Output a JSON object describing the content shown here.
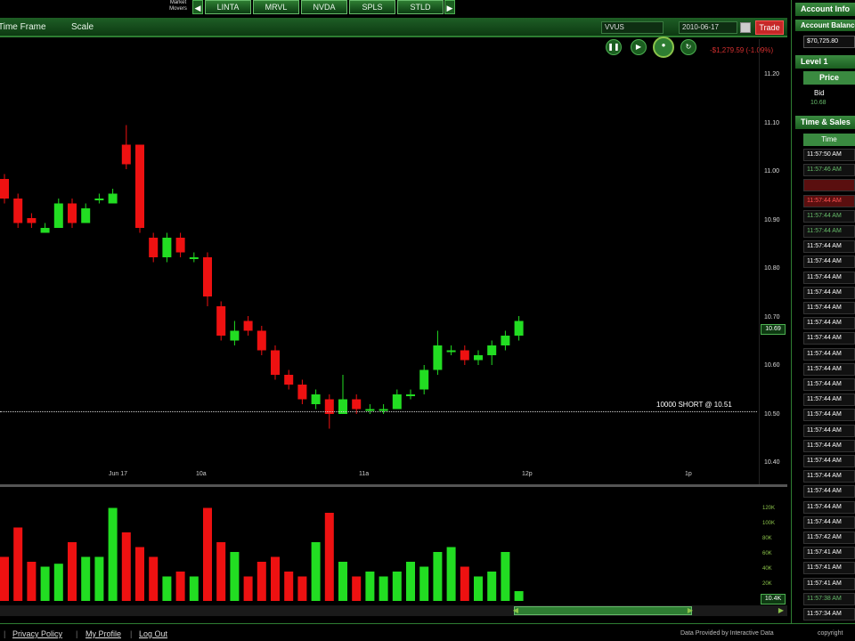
{
  "top_strip": {
    "movers_label": "Market Movers",
    "tickers": [
      "LINTA",
      "MRVL",
      "NVDA",
      "SPLS",
      "STLD"
    ]
  },
  "chart_header": {
    "time_frame_label": "Time Frame",
    "scale_label": "Scale",
    "symbol": "VVUS",
    "date": "2010-06-17",
    "trade_label": "Trade",
    "pnl": "-$1,279.59 (-1.09%)"
  },
  "price_axis": [
    "11.20",
    "11.10",
    "11.00",
    "10.90",
    "10.80",
    "10.70",
    "10.60",
    "10.50",
    "10.40"
  ],
  "current_price": "10.69",
  "position": "10000 SHORT @ 10.51",
  "time_axis": [
    "Jun 17",
    "10a",
    "11a",
    "12p",
    "1p"
  ],
  "volume_axis": [
    "120K",
    "100K",
    "80K",
    "60K",
    "40K",
    "20K"
  ],
  "volume_current": "10.4K",
  "chart_data": {
    "type": "candlestick",
    "ylim": [
      10.4,
      11.2
    ],
    "candles": [
      {
        "o": 10.98,
        "c": 10.94,
        "h": 10.99,
        "l": 10.93
      },
      {
        "o": 10.94,
        "c": 10.89,
        "h": 10.95,
        "l": 10.88
      },
      {
        "o": 10.9,
        "c": 10.89,
        "h": 10.91,
        "l": 10.88
      },
      {
        "o": 10.87,
        "c": 10.88,
        "h": 10.89,
        "l": 10.87
      },
      {
        "o": 10.88,
        "c": 10.93,
        "h": 10.94,
        "l": 10.88
      },
      {
        "o": 10.93,
        "c": 10.89,
        "h": 10.94,
        "l": 10.88
      },
      {
        "o": 10.89,
        "c": 10.92,
        "h": 10.93,
        "l": 10.89
      },
      {
        "o": 10.94,
        "c": 10.94,
        "h": 10.95,
        "l": 10.93
      },
      {
        "o": 10.93,
        "c": 10.95,
        "h": 10.96,
        "l": 10.93
      },
      {
        "o": 11.05,
        "c": 11.01,
        "h": 11.09,
        "l": 11.0
      },
      {
        "o": 11.05,
        "c": 10.88,
        "h": 11.05,
        "l": 10.87
      },
      {
        "o": 10.86,
        "c": 10.82,
        "h": 10.87,
        "l": 10.81
      },
      {
        "o": 10.82,
        "c": 10.86,
        "h": 10.87,
        "l": 10.81
      },
      {
        "o": 10.86,
        "c": 10.83,
        "h": 10.87,
        "l": 10.82
      },
      {
        "o": 10.82,
        "c": 10.82,
        "h": 10.83,
        "l": 10.81
      },
      {
        "o": 10.82,
        "c": 10.74,
        "h": 10.83,
        "l": 10.72
      },
      {
        "o": 10.72,
        "c": 10.66,
        "h": 10.73,
        "l": 10.65
      },
      {
        "o": 10.65,
        "c": 10.67,
        "h": 10.69,
        "l": 10.64
      },
      {
        "o": 10.69,
        "c": 10.67,
        "h": 10.7,
        "l": 10.66
      },
      {
        "o": 10.67,
        "c": 10.63,
        "h": 10.68,
        "l": 10.62
      },
      {
        "o": 10.63,
        "c": 10.58,
        "h": 10.64,
        "l": 10.57
      },
      {
        "o": 10.58,
        "c": 10.56,
        "h": 10.59,
        "l": 10.55
      },
      {
        "o": 10.56,
        "c": 10.53,
        "h": 10.57,
        "l": 10.52
      },
      {
        "o": 10.52,
        "c": 10.54,
        "h": 10.55,
        "l": 10.51
      },
      {
        "o": 10.53,
        "c": 10.5,
        "h": 10.54,
        "l": 10.47
      },
      {
        "o": 10.5,
        "c": 10.53,
        "h": 10.58,
        "l": 10.5
      },
      {
        "o": 10.53,
        "c": 10.51,
        "h": 10.54,
        "l": 10.5
      },
      {
        "o": 10.51,
        "c": 10.51,
        "h": 10.52,
        "l": 10.5
      },
      {
        "o": 10.51,
        "c": 10.51,
        "h": 10.52,
        "l": 10.5
      },
      {
        "o": 10.51,
        "c": 10.54,
        "h": 10.55,
        "l": 10.51
      },
      {
        "o": 10.54,
        "c": 10.54,
        "h": 10.55,
        "l": 10.53
      },
      {
        "o": 10.55,
        "c": 10.59,
        "h": 10.6,
        "l": 10.54
      },
      {
        "o": 10.59,
        "c": 10.64,
        "h": 10.67,
        "l": 10.58
      },
      {
        "o": 10.63,
        "c": 10.63,
        "h": 10.64,
        "l": 10.62
      },
      {
        "o": 10.63,
        "c": 10.61,
        "h": 10.64,
        "l": 10.6
      },
      {
        "o": 10.61,
        "c": 10.62,
        "h": 10.63,
        "l": 10.6
      },
      {
        "o": 10.62,
        "c": 10.64,
        "h": 10.65,
        "l": 10.6
      },
      {
        "o": 10.64,
        "c": 10.66,
        "h": 10.67,
        "l": 10.63
      },
      {
        "o": 10.66,
        "c": 10.69,
        "h": 10.7,
        "l": 10.65
      }
    ],
    "volume": [
      45,
      75,
      40,
      35,
      38,
      60,
      45,
      45,
      95,
      70,
      55,
      45,
      25,
      30,
      25,
      95,
      60,
      50,
      25,
      40,
      45,
      30,
      25,
      60,
      90,
      40,
      25,
      30,
      25,
      30,
      40,
      35,
      50,
      55,
      35,
      25,
      30,
      50,
      10
    ]
  },
  "right_panel": {
    "account_info_title": "Account Info",
    "account_balance_label": "Account Balance",
    "account_balance": "$70,725.80",
    "level1_title": "Level 1",
    "price_col": "Price",
    "bid_label": "Bid",
    "bid_value": "10.68",
    "time_sales_title": "Time & Sales",
    "time_col": "Time",
    "rows": [
      {
        "t": "11:57:50 AM",
        "s": "n"
      },
      {
        "t": "11:57:46 AM",
        "s": "g"
      },
      {
        "t": "",
        "s": "r"
      },
      {
        "t": "11:57:44 AM",
        "s": "r"
      },
      {
        "t": "11:57:44 AM",
        "s": "g"
      },
      {
        "t": "11:57:44 AM",
        "s": "g"
      },
      {
        "t": "11:57:44 AM",
        "s": "n"
      },
      {
        "t": "11:57:44 AM",
        "s": "n"
      },
      {
        "t": "11:57:44 AM",
        "s": "n"
      },
      {
        "t": "11:57:44 AM",
        "s": "n"
      },
      {
        "t": "11:57:44 AM",
        "s": "n"
      },
      {
        "t": "11:57:44 AM",
        "s": "n"
      },
      {
        "t": "11:57:44 AM",
        "s": "n"
      },
      {
        "t": "11:57:44 AM",
        "s": "n"
      },
      {
        "t": "11:57:44 AM",
        "s": "n"
      },
      {
        "t": "11:57:44 AM",
        "s": "n"
      },
      {
        "t": "11:57:44 AM",
        "s": "n"
      },
      {
        "t": "11:57:44 AM",
        "s": "n"
      },
      {
        "t": "11:57:44 AM",
        "s": "n"
      },
      {
        "t": "11:57:44 AM",
        "s": "n"
      },
      {
        "t": "11:57:44 AM",
        "s": "n"
      },
      {
        "t": "11:57:44 AM",
        "s": "n"
      },
      {
        "t": "11:57:44 AM",
        "s": "n"
      },
      {
        "t": "11:57:44 AM",
        "s": "n"
      },
      {
        "t": "11:57:44 AM",
        "s": "n"
      },
      {
        "t": "11:57:42 AM",
        "s": "n"
      },
      {
        "t": "11:57:41 AM",
        "s": "n"
      },
      {
        "t": "11:57:41 AM",
        "s": "n"
      },
      {
        "t": "11:57:41 AM",
        "s": "n"
      },
      {
        "t": "11:57:38 AM",
        "s": "g"
      },
      {
        "t": "11:57:34 AM",
        "s": "n"
      }
    ]
  },
  "footer": {
    "privacy": "Privacy Policy",
    "profile": "My Profile",
    "logout": "Log Out",
    "data_by": "Data Provided by Interactive Data",
    "copyright": "copyright"
  },
  "colors": {
    "up": "#22dd22",
    "down": "#ee1111",
    "accent": "#2e7d32"
  }
}
